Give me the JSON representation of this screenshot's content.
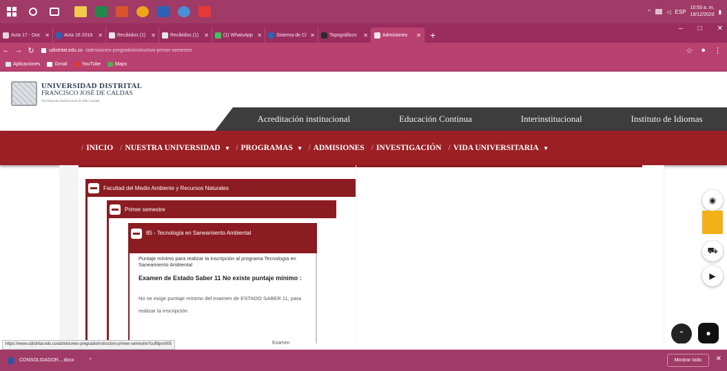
{
  "browser": {
    "tabs": [
      {
        "label": "Acta 17 - Doc",
        "color": "#e8d1dc"
      },
      {
        "label": "Acta 16 2018",
        "color": "#2b63b5"
      },
      {
        "label": "Recibidos (1)",
        "color": "#e6e6e6"
      },
      {
        "label": "Recibidos (1)",
        "color": "#e6e6e6"
      },
      {
        "label": "(1) WhatsApp",
        "color": "#3fc35a"
      },
      {
        "label": "Sistema de Ci",
        "color": "#2b63b5"
      },
      {
        "label": "Topográficos",
        "color": "#2b2b2b"
      },
      {
        "label": "Admisiones",
        "color": "#f2e6ec"
      }
    ],
    "url_host": "udistrital.edu.co",
    "url_path": "/admisiones-pregrado/instructivo-primer-semestre",
    "bookmarks": [
      {
        "label": "Aplicaciones",
        "color": "#d8e3f5"
      },
      {
        "label": "Gmail",
        "color": "#ffffff"
      },
      {
        "label": "YouTube",
        "color": "#e53935"
      },
      {
        "label": "Maps",
        "color": "#4caf50"
      }
    ],
    "status_url": "https://www.udistrital.edu.co/admisiones-pregrado/instructivo-primer-semestre?cufiltpro005",
    "status_tail": "Examen"
  },
  "taskbar": {
    "clock_time": "10:53 a. m.",
    "clock_date": "18/12/2020",
    "lang": "ESP"
  },
  "site": {
    "logo_line1": "UNIVERSIDAD DISTRITAL",
    "logo_line2": "FRANCISCO JOSÉ DE CALDAS",
    "logo_line3": "Acreditación Institucional de Alta Calidad",
    "topnav": [
      "Acreditación institucional",
      "Educación Continua",
      "Interinstitucional",
      "Instituto de Idiomas"
    ],
    "mainnav": [
      {
        "label": "INICIO",
        "caret": ""
      },
      {
        "label": "NUESTRA UNIVERSIDAD",
        "caret": "▾"
      },
      {
        "label": "PROGRAMAS",
        "caret": "▾"
      },
      {
        "label": "ADMISIONES",
        "caret": ""
      },
      {
        "label": "INVESTIGACIÓN",
        "caret": ""
      },
      {
        "label": "VIDA UNIVERSITARIA",
        "caret": "▾"
      }
    ],
    "slash": "/"
  },
  "accordion": {
    "faculty": "Facultad del Medio Ambiente y Recursos Naturales",
    "semester": "Primer semestre",
    "program": "85 - Tecnología en Saneamiento Ambiental",
    "detail_intro": "Puntaje mínimo para realizar la inscripción al programa Tecnología en Saneamiento Ambiental",
    "detail_heading": "Examen de Estado Saber 11 No existe puntaje mínimo :",
    "detail_body": "No se exige puntaje mínimo del examen de ESTADO SABER 11, para realizar la inscripción."
  },
  "download": {
    "file": "CONSOLIDADOR....docx",
    "more": "^",
    "show_all": "Mostrar todo",
    "close": "✕"
  }
}
